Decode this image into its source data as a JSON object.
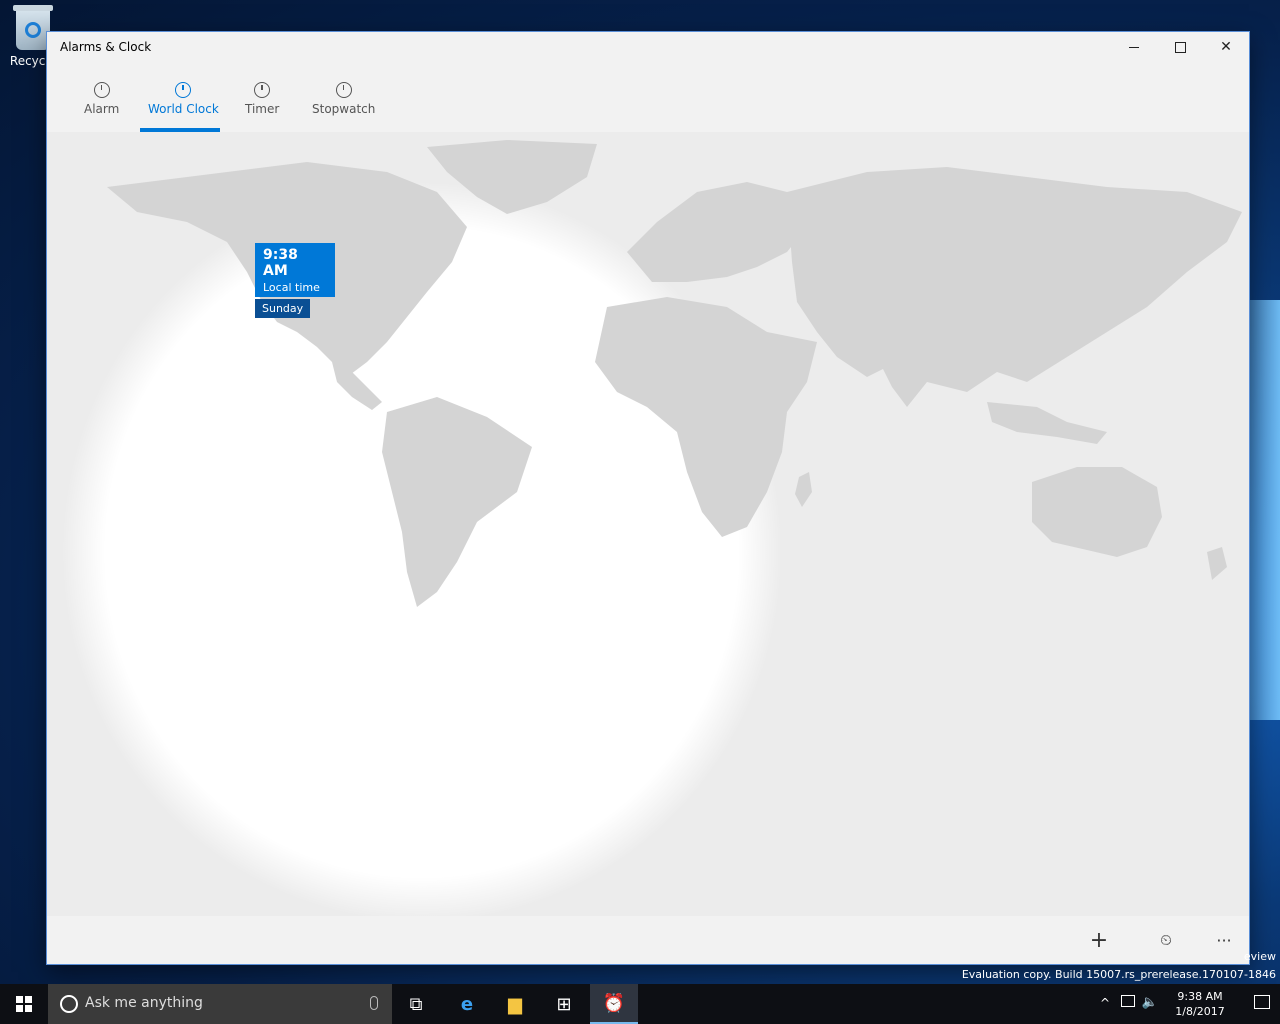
{
  "desktop": {
    "recycle_bin_label": "Recycle"
  },
  "window": {
    "title": "Alarms & Clock",
    "min_label": "–",
    "max_label": "□",
    "close_label": "✕"
  },
  "tabs": [
    {
      "label": "Alarm",
      "icon": "alarm-clock-icon"
    },
    {
      "label": "World Clock",
      "icon": "globe-clock-icon",
      "active": true
    },
    {
      "label": "Timer",
      "icon": "timer-icon"
    },
    {
      "label": "Stopwatch",
      "icon": "stopwatch-icon"
    }
  ],
  "map": {
    "local_pin": {
      "time": "9:38 AM",
      "label": "Local time",
      "day": "Sunday"
    }
  },
  "appbar": {
    "add": "+",
    "compare": "⏲",
    "more": "···"
  },
  "watermark": {
    "line1": "eview",
    "line2": "Evaluation copy. Build 15007.rs_prerelease.170107-1846"
  },
  "taskbar": {
    "search_placeholder": "Ask me anything",
    "clock_time": "9:38 AM",
    "clock_date": "1/8/2017"
  },
  "colors": {
    "accent": "#0078d7",
    "land": "#d4d4d4",
    "night": "#ececec"
  }
}
